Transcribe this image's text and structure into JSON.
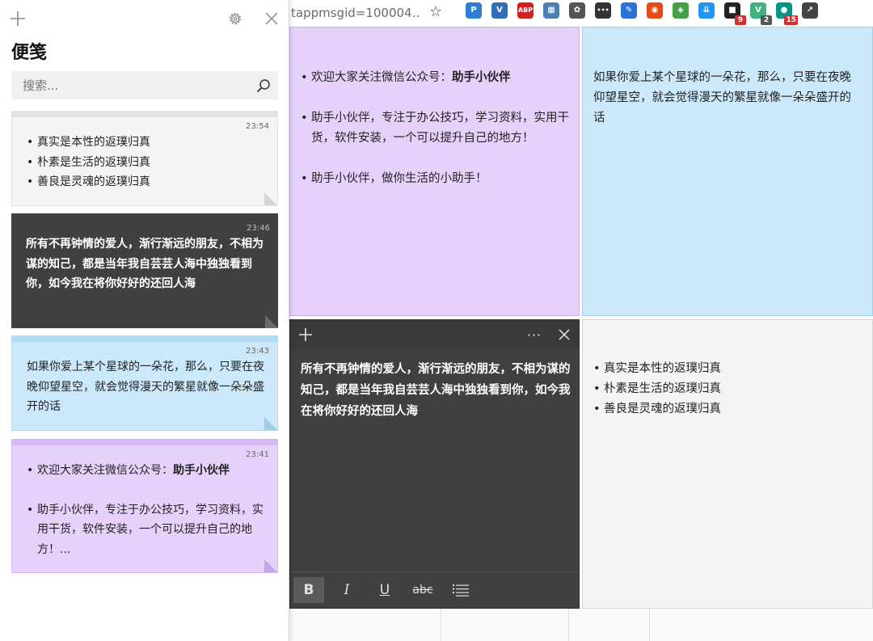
{
  "browser": {
    "url_fragment": "tappmsgid=100004…",
    "star_glyph": "☆",
    "extensions": [
      {
        "name": "p-extension",
        "glyph": "P",
        "color": "#2d7fd6",
        "badge": ""
      },
      {
        "name": "v-extension",
        "glyph": "V",
        "color": "#2f6fb8",
        "badge": ""
      },
      {
        "name": "abp-extension",
        "glyph": "ABP",
        "color": "#d42020",
        "badge": ""
      },
      {
        "name": "grid-extension",
        "glyph": "▦",
        "color": "#4a7fb0",
        "badge": ""
      },
      {
        "name": "paw-extension",
        "glyph": "✿",
        "color": "#555555",
        "badge": ""
      },
      {
        "name": "dots-extension",
        "glyph": "•••",
        "color": "#333333",
        "badge": ""
      },
      {
        "name": "pen-extension",
        "glyph": "✎",
        "color": "#2a72d6",
        "badge": ""
      },
      {
        "name": "pin-extension",
        "glyph": "◉",
        "color": "#e64a19",
        "badge": ""
      },
      {
        "name": "swatch-extension",
        "glyph": "◈",
        "color": "#43a047",
        "badge": ""
      },
      {
        "name": "save-extension",
        "glyph": "⇊",
        "color": "#2196f3",
        "badge": ""
      },
      {
        "name": "mail-extension",
        "glyph": "■",
        "color": "#222222",
        "badge": "9"
      },
      {
        "name": "vue-extension",
        "glyph": "V",
        "color": "#3fb27f",
        "badge": "2"
      },
      {
        "name": "globe-extension",
        "glyph": "●",
        "color": "#009688",
        "badge": "15"
      },
      {
        "name": "chart-extension",
        "glyph": "↗",
        "color": "#444444",
        "badge": ""
      }
    ]
  },
  "panel": {
    "title": "便笺",
    "search_placeholder": "搜索...",
    "notes": [
      {
        "time": "23:54",
        "lines": [
          "真实是本性的返璞归真",
          "朴素是生活的返璞归真",
          "善良是灵魂的返璞归真"
        ]
      },
      {
        "time": "23:46",
        "text": "所有不再钟情的爱人，渐行渐远的朋友，不相为谋的知己，都是当年我自芸芸人海中独独看到你，如今我在将你好好的还回人海"
      },
      {
        "time": "23:43",
        "text": "如果你爱上某个星球的一朵花，那么，只要在夜晚仰望星空，就会觉得漫天的繁星就像一朵朵盛开的话"
      },
      {
        "time": "23:41",
        "line1_prefix": "欢迎大家关注微信公众号：",
        "line1_bold": "助手小伙伴",
        "line2": "助手小伙伴，专注于办公技巧，学习资料，实用干货，软件安装，一个可以提升自己的地方！..."
      }
    ]
  },
  "notes": {
    "purple": {
      "line1_prefix": "欢迎大家关注微信公众号：",
      "line1_bold": "助手小伙伴",
      "line2": "助手小伙伴，专注于办公技巧，学习资料，实用干货，软件安装，一个可以提升自己的地方！",
      "line3": "助手小伙伴，做你生活的小助手！"
    },
    "blue": {
      "text": "如果你爱上某个星球的一朵花，那么，只要在夜晚仰望星空，就会觉得漫天的繁星就像一朵朵盛开的话"
    },
    "dark": {
      "text": "所有不再钟情的爱人，渐行渐远的朋友，不相为谋的知己，都是当年我自芸芸人海中独独看到你，如今我在将你好好的还回人海",
      "menu_glyph": "···",
      "toolbar": {
        "bold": "B",
        "italic": "I",
        "underline": "U",
        "strike": "abc"
      }
    },
    "white": {
      "lines": [
        "真实是本性的返璞归真",
        "朴素是生活的返璞归真",
        "善良是灵魂的返璞归真"
      ]
    }
  },
  "colors": {
    "white_note": "#f5f5f5",
    "white_band": "#e3e3e3",
    "dark_note": "#404040",
    "blue_note": "#cce9fb",
    "blue_band": "#b3dcf5",
    "purple_note": "#e6d1fa",
    "purple_band": "#d6b8f5"
  }
}
